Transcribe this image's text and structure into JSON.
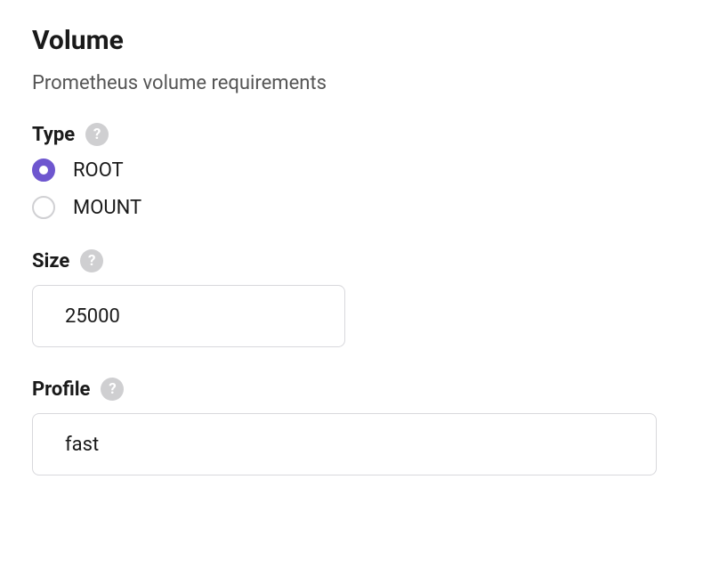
{
  "section": {
    "title": "Volume",
    "subtitle": "Prometheus volume requirements"
  },
  "fields": {
    "type": {
      "label": "Type",
      "options": {
        "root": "ROOT",
        "mount": "MOUNT"
      },
      "selected": "root"
    },
    "size": {
      "label": "Size",
      "value": "25000"
    },
    "profile": {
      "label": "Profile",
      "value": "fast"
    }
  },
  "help_glyph": "?"
}
